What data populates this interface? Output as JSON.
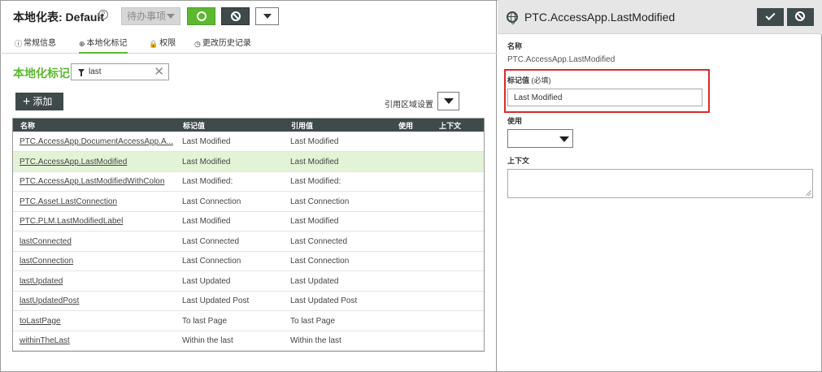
{
  "header": {
    "title": "本地化表: Default",
    "todo_label": "待办事项"
  },
  "tabs": [
    {
      "icon": "ⓘ",
      "label": "常规信息"
    },
    {
      "icon": "⊕",
      "label": "本地化标记"
    },
    {
      "icon": "🔒",
      "label": "权限"
    },
    {
      "icon": "◷",
      "label": "更改历史记录"
    }
  ],
  "section": {
    "title": "本地化标记",
    "filter_value": "last",
    "add_label": "添加",
    "ref_area_label": "引用区域设置"
  },
  "table": {
    "columns": [
      "名称",
      "标记值",
      "引用值",
      "使用",
      "上下文"
    ],
    "rows": [
      {
        "name": "PTC.AccessApp.DocumentAccessApp.A...",
        "token": "Last Modified",
        "ref": "Last Modified"
      },
      {
        "name": "PTC.AccessApp.LastModified",
        "token": "Last Modified",
        "ref": "Last Modified"
      },
      {
        "name": "PTC.AccessApp.LastModifiedWithColon",
        "token": "Last Modified:",
        "ref": "Last Modified:"
      },
      {
        "name": "PTC.Asset.LastConnection",
        "token": "Last Connection",
        "ref": "Last Connection"
      },
      {
        "name": "PTC.PLM.LastModifiedLabel",
        "token": "Last Modified",
        "ref": "Last Modified"
      },
      {
        "name": "lastConnected",
        "token": "Last Connected",
        "ref": "Last Connected"
      },
      {
        "name": "lastConnection",
        "token": "Last Connection",
        "ref": "Last Connection"
      },
      {
        "name": "lastUpdated",
        "token": "Last Updated",
        "ref": "Last Updated"
      },
      {
        "name": "lastUpdatedPost",
        "token": "Last Updated Post",
        "ref": "Last Updated Post"
      },
      {
        "name": "toLastPage",
        "token": "To last Page",
        "ref": "To last Page"
      },
      {
        "name": "withinTheLast",
        "token": "Within the last",
        "ref": "Within the last"
      }
    ],
    "selected_index": 1
  },
  "detail": {
    "title": "PTC.AccessApp.LastModified",
    "name_label": "名称",
    "name_value": "PTC.AccessApp.LastModified",
    "token_label": "标记值",
    "token_required": "(必填)",
    "token_value": "Last Modified",
    "use_label": "使用",
    "context_label": "上下文"
  },
  "colors": {
    "accent_green": "#5bb82f",
    "dark_button": "#3f4a4b",
    "selected_row": "#e3f4d6",
    "highlight_red": "#d92b2b"
  }
}
